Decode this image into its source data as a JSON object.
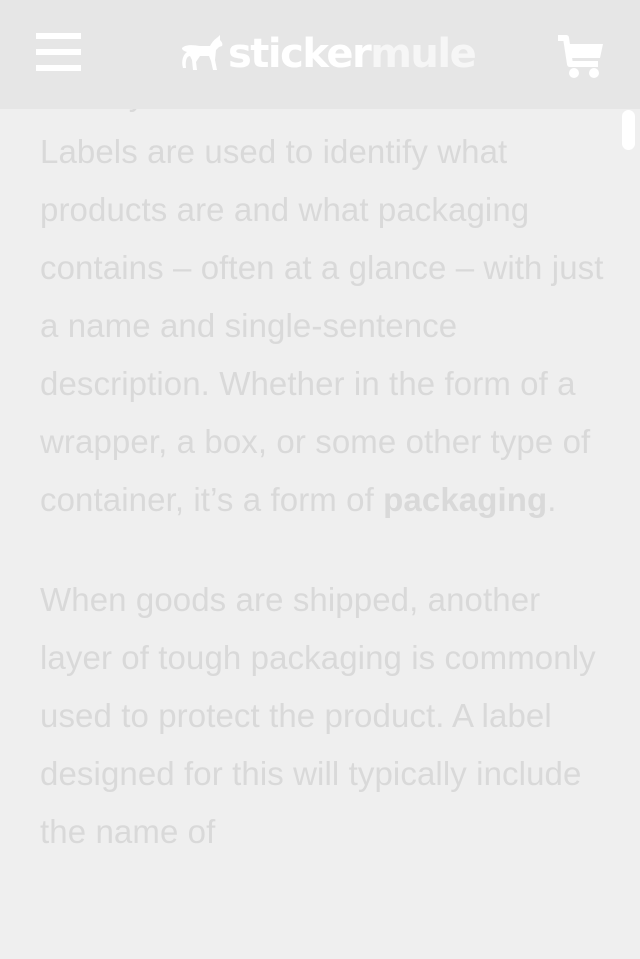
{
  "header": {
    "menu_icon": "hamburger-menu-icon",
    "logo_icon": "mule-logo-icon",
    "logo_word_1": "sticker",
    "logo_word_2": "mule",
    "cart_icon": "shopping-cart-icon",
    "background": "#e6e6e6",
    "icon_color": "#ffffff"
  },
  "article": {
    "partial_line": "identity!",
    "paragraph_1": {
      "text_before": "Labels are used to identify what products are and what packaging contains – often at a glance – with just a name and single-sentence description. Whether in the form of a wrapper, a box, or some other type of container, it’s a form of ",
      "link_text": "packaging",
      "text_after": "."
    },
    "paragraph_2": "When goods are shipped, another layer of tough packaging is commonly used to protect the product. A label designed for this will typically include the name of",
    "text_color": "#d9d9d9"
  }
}
